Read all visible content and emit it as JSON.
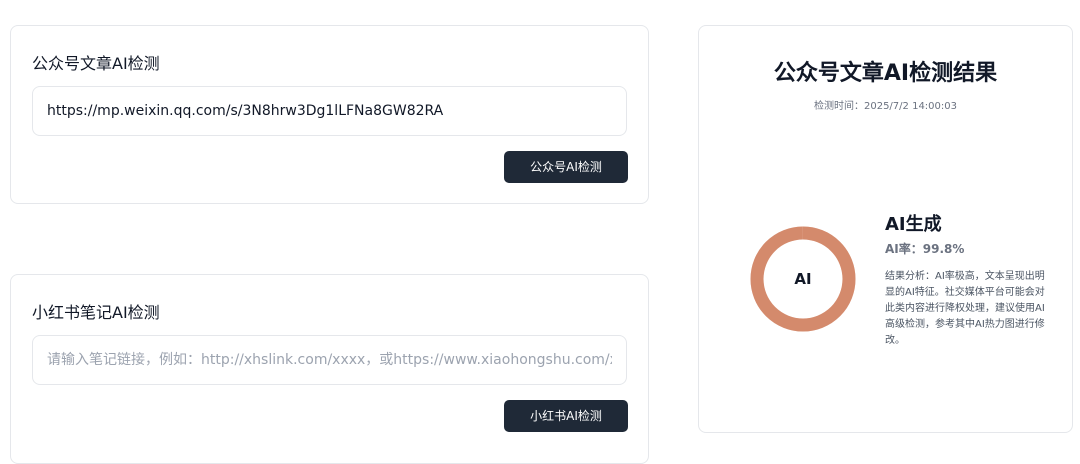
{
  "wechat": {
    "title": "公众号文章AI检测",
    "url_value": "https://mp.weixin.qq.com/s/3N8hrw3Dg1lLFNa8GW82RA",
    "button_label": "公众号AI检测"
  },
  "xiaohongshu": {
    "title": "小红书笔记AI检测",
    "placeholder": "请输入笔记链接，例如：http://xhslink.com/xxxx，或https://www.xiaohongshu.com/xxx",
    "button_label": "小红书AI检测"
  },
  "result": {
    "title": "公众号文章AI检测结果",
    "time_label": "检测时间：",
    "time_value": "2025/7/2 14:00:03",
    "donut_label": "AI",
    "ai_percent": 99.8,
    "verdict": "AI生成",
    "rate_label": "AI率：",
    "rate_value": "99.8%",
    "analysis_label": "结果分析：",
    "analysis_text": "AI率极高，文本呈现出明显的AI特征。社交媒体平台可能会对此类内容进行降权处理，建议使用AI高级检测，参考其中AI热力图进行修改。",
    "colors": {
      "ai": "#d48a6c",
      "human": "#f3d9cd"
    }
  }
}
